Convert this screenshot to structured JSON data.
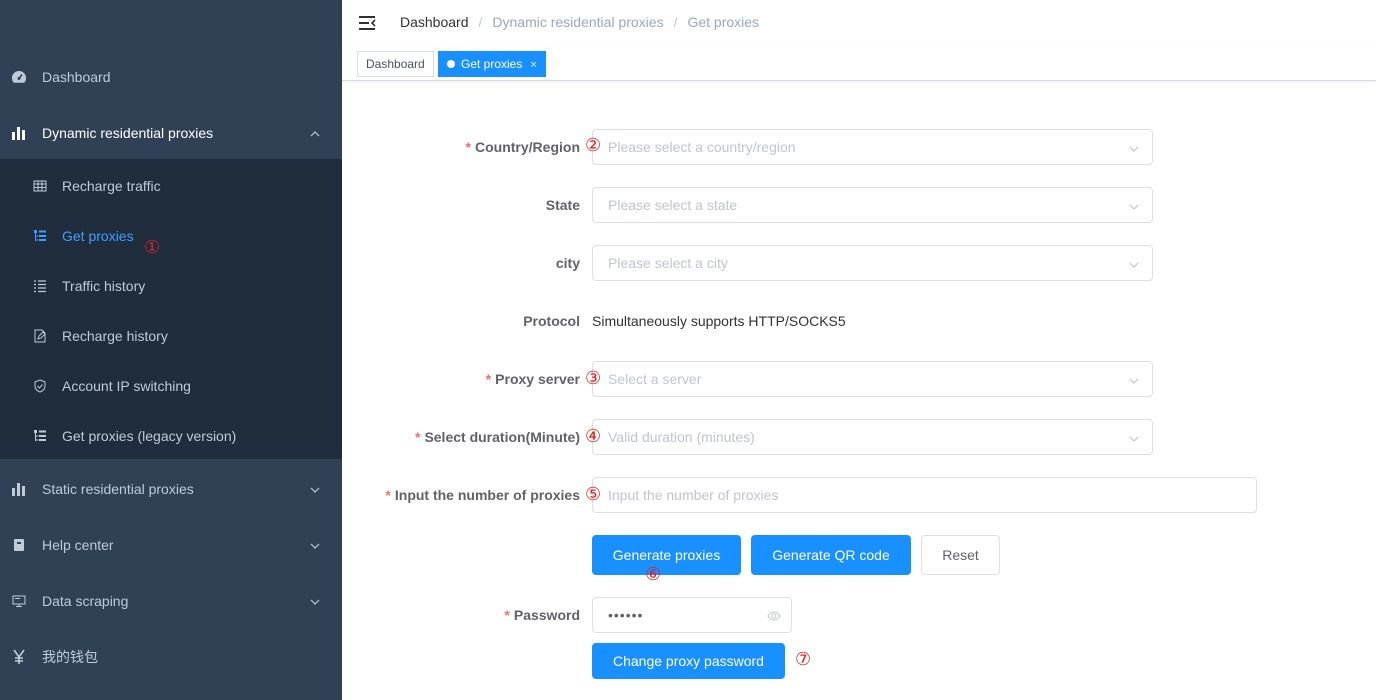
{
  "sidebar": {
    "top_items": [
      {
        "label": "Dashboard",
        "icon": "dashboard-icon"
      },
      {
        "label": "Dynamic residential proxies",
        "icon": "bar-chart-icon",
        "expanded": true
      },
      {
        "label": "Static residential proxies",
        "icon": "bar-chart-icon"
      },
      {
        "label": "Help center",
        "icon": "book-icon"
      },
      {
        "label": "Data scraping",
        "icon": "monitor-icon"
      },
      {
        "label": "我的钱包",
        "icon": "yen-icon"
      }
    ],
    "sub_items": [
      {
        "label": "Recharge traffic",
        "icon": "table-icon"
      },
      {
        "label": "Get proxies",
        "icon": "list-tree-icon",
        "active": true
      },
      {
        "label": "Traffic history",
        "icon": "list-icon"
      },
      {
        "label": "Recharge history",
        "icon": "edit-icon"
      },
      {
        "label": "Account IP switching",
        "icon": "shield-icon"
      },
      {
        "label": "Get proxies (legacy version)",
        "icon": "list-tree-icon"
      }
    ]
  },
  "header": {
    "breadcrumb": [
      "Dashboard",
      "Dynamic residential proxies",
      "Get proxies"
    ],
    "separator": "/"
  },
  "tags": {
    "items": [
      {
        "label": "Dashboard"
      },
      {
        "label": "Get proxies",
        "active": true,
        "close": "×"
      }
    ]
  },
  "form": {
    "country": {
      "label": "Country/Region",
      "placeholder": "Please select a country/region",
      "required": true
    },
    "state": {
      "label": "State",
      "placeholder": "Please select a state"
    },
    "city": {
      "label": "city",
      "placeholder": "Please select a city"
    },
    "protocol": {
      "label": "Protocol",
      "value": "Simultaneously supports HTTP/SOCKS5"
    },
    "server": {
      "label": "Proxy server",
      "placeholder": "Select a server",
      "required": true
    },
    "duration": {
      "label": "Select duration(Minute)",
      "placeholder": "Valid duration (minutes)",
      "required": true
    },
    "count": {
      "label": "Input the number of proxies",
      "placeholder": "Input the number of proxies",
      "required": true
    },
    "buttons": {
      "generate": "Generate proxies",
      "qr": "Generate QR code",
      "reset": "Reset"
    },
    "password": {
      "label": "Password",
      "value": "••••••",
      "required": true
    },
    "change_password": "Change proxy password",
    "required_mark": "*"
  },
  "annotations": [
    "①",
    "②",
    "③",
    "④",
    "⑤",
    "⑥",
    "⑦"
  ],
  "colors": {
    "sidebar_bg": "#304156",
    "submenu_bg": "#1f2d3d",
    "primary": "#1890ff",
    "active_text": "#409eff",
    "annotation": "#e02020"
  }
}
